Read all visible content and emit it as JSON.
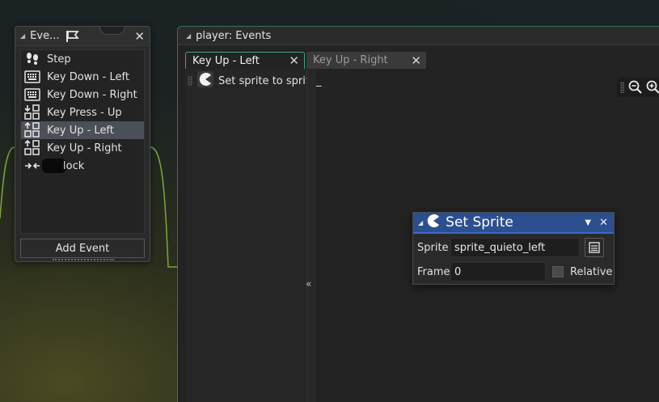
{
  "events_panel": {
    "title": "Eve...",
    "items": [
      {
        "label": "Step",
        "icon": "footsteps-icon"
      },
      {
        "label": "Key Down - Left",
        "icon": "keyboard-icon"
      },
      {
        "label": "Key Down - Right",
        "icon": "keyboard-icon"
      },
      {
        "label": "Key Press - Up",
        "icon": "key-press-icon"
      },
      {
        "label": "Key Up - Left",
        "icon": "key-up-icon",
        "selected": true
      },
      {
        "label": "Key Up - Right",
        "icon": "key-up-icon"
      },
      {
        "label": "lock",
        "icon": "collision-icon"
      }
    ],
    "add_event_label": "Add Event"
  },
  "main_panel": {
    "title": "player: Events",
    "tabs": [
      {
        "label": "Key Up - Left",
        "active": true
      },
      {
        "label": "Key Up - Right",
        "active": false
      }
    ],
    "actions": [
      {
        "label": "Set sprite to sprite_",
        "icon": "sprite-pacman-icon"
      }
    ],
    "collapse_glyph": "«"
  },
  "set_sprite": {
    "title": "Set Sprite",
    "sprite_label": "Sprite",
    "sprite_value": "sprite_quieto_left",
    "frame_label": "Frame",
    "frame_value": "0",
    "relative_label": "Relative",
    "relative_checked": false
  },
  "colors": {
    "accent_green": "#3fa582",
    "header_blue": "#2c4f8f",
    "selection": "#4b5058"
  }
}
